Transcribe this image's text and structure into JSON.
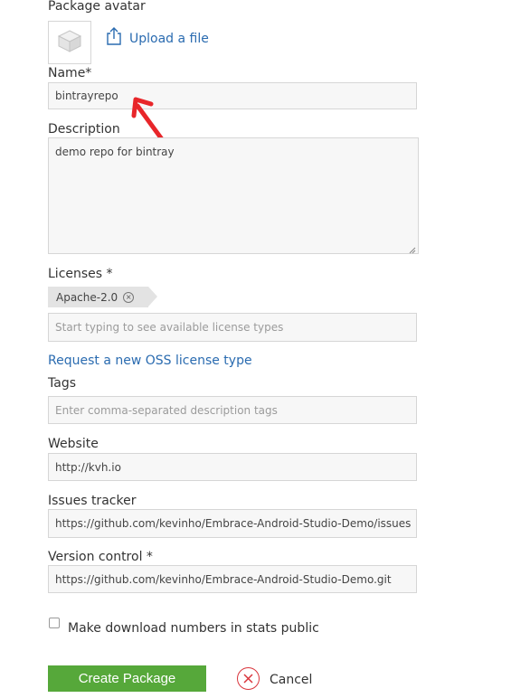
{
  "avatar": {
    "label": "Package avatar",
    "upload_link": "Upload a file",
    "upload_icon": "upload-icon",
    "placeholder_icon": "package-cube-icon"
  },
  "name": {
    "label": "Name*",
    "value": "bintrayrepo",
    "annotation_icon": "red-arrow-icon"
  },
  "description": {
    "label": "Description",
    "value": "demo repo for bintray"
  },
  "licenses": {
    "label": "Licenses *",
    "selected": [
      "Apache-2.0"
    ],
    "input_placeholder": "Start typing to see available license types",
    "request_link": "Request a new OSS license type"
  },
  "tags": {
    "label": "Tags",
    "placeholder": "Enter comma-separated description tags"
  },
  "website": {
    "label": "Website",
    "value": "http://kvh.io"
  },
  "issues_tracker": {
    "label": "Issues tracker",
    "value": "https://github.com/kevinho/Embrace-Android-Studio-Demo/issues"
  },
  "version_control": {
    "label": "Version control *",
    "value": "https://github.com/kevinho/Embrace-Android-Studio-Demo.git"
  },
  "stats_public": {
    "label": "Make download numbers in stats public",
    "checked": false
  },
  "actions": {
    "create_label": "Create Package",
    "cancel_label": "Cancel",
    "cancel_icon": "close-circle-icon"
  },
  "colors": {
    "create_button": "#56a83a",
    "cancel_icon": "#d9343b",
    "link": "#2a6bb0",
    "annotation_arrow": "#e8262a"
  }
}
